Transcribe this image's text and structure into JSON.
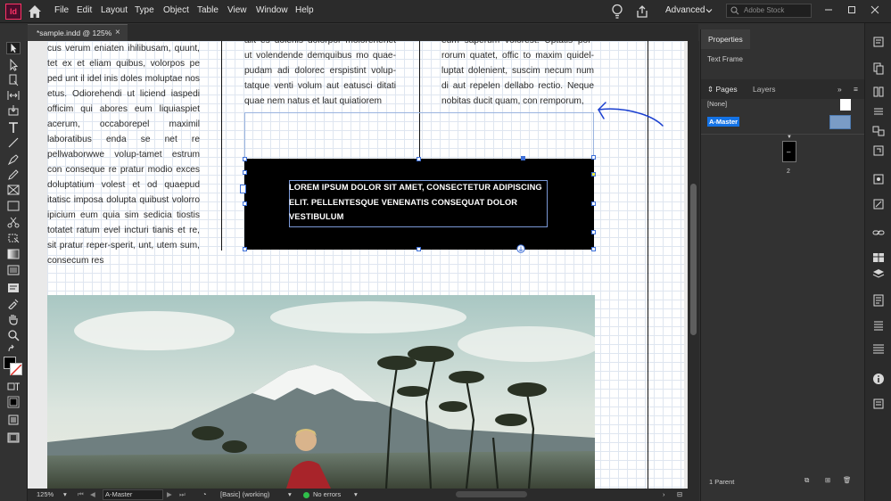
{
  "app": {
    "logo_text": "Id"
  },
  "menu": {
    "items": [
      "File",
      "Edit",
      "Layout",
      "Type",
      "Object",
      "Table",
      "View",
      "Window",
      "Help"
    ],
    "workspace": "Advanced",
    "stock_placeholder": "Adobe Stock"
  },
  "document": {
    "tab_title": "*sample.indd @ 125%",
    "close_glyph": "×"
  },
  "page_text": {
    "col1": "cus verum eniaten ihilibusam, quunt, tet ex et eliam quibus, volorpos pe ped unt il idel inis doles moluptae nos etus. Odiorehendi ut liciend iaspedi officim qui abores eum liquiaspiet acerum, occaborepel maximil laboratibus enda se net re pellwaborwwe volup-tamet estrum con conseque re pratur modio exces doluptatium volest et od quaepud itatisc imposa dolupta quibust volorro ipicium eum quia sim sedicia tiostis totatet ratum evel incturi tianis et re, sit pratur reper-sperit, unt, utem sum, consecum res",
    "col2": "alit es dolenis dolorpor molorehenet ut volendende demquibus mo quae-pudam adi dolorec erspistint volup-tatque venti volum aut eatusci ditati quae nem natus et laut quiatiorem",
    "col3": "eum saperum volorest. Uptatis por-rorum quatet, offic to maxim quidel-luptat dolenient, suscim necum num di aut repelen dellabo rectio. Neque nobitas ducit quam, con remporum,",
    "frame_heading": "LOREM IPSUM DOLOR SIT AMET, CONSECTETUR ADIPISCING ELIT. PELLENTESQUE VENENATIS CONSEQUAT DOLOR VESTIBULUM"
  },
  "status": {
    "zoom": "125%",
    "master": "A-Master",
    "preflight_profile": "[Basic] (working)",
    "errors": "No errors"
  },
  "properties": {
    "tab": "Properties",
    "selection_type": "Text Frame"
  },
  "pages_panel": {
    "tabs": [
      "Pages",
      "Layers"
    ],
    "none_label": "[None]",
    "master_label": "A-Master",
    "thumb_label": "–",
    "page_number": "2",
    "footer": "1 Parent"
  },
  "colors": {
    "accent": "#1473e6",
    "frame_edge": "#3d6fd8",
    "annotation_arrow": "#1a3fd0",
    "status_ok": "#2fbf4a"
  }
}
